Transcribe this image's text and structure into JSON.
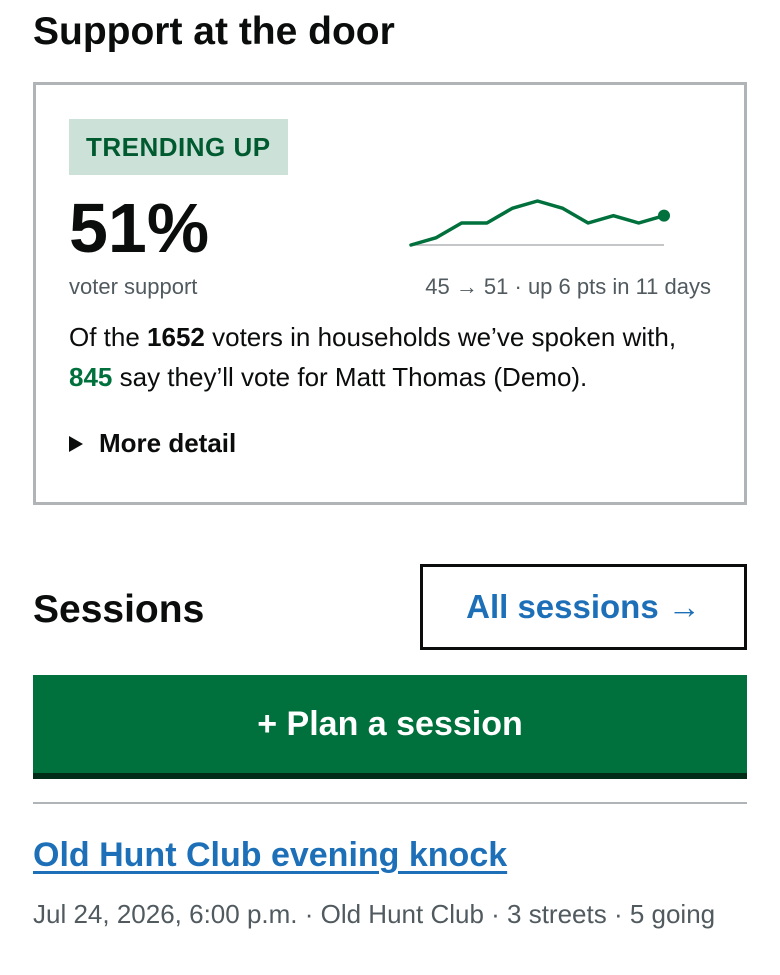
{
  "support": {
    "title": "Support at the door",
    "tag": "TRENDING UP",
    "percent": "51%",
    "percent_label": "voter support",
    "trend_caption": "45 → 51 · up 6 pts in 11 days",
    "trend_values": [
      45,
      46,
      48,
      48,
      50,
      51,
      50,
      48,
      49,
      48,
      49
    ],
    "colors": {
      "accent_green": "#00703c",
      "tag_bg": "#cce2d8",
      "link_blue": "#1d70b8"
    },
    "summary": {
      "part1": "Of the ",
      "voters": "1652",
      "part2": " voters in households we’ve spoken with, ",
      "supporters": "845",
      "part3": " say they’ll vote for Matt Thomas (Demo)."
    },
    "more_detail": "More detail"
  },
  "sessions": {
    "title": "Sessions",
    "all_link": "All sessions →",
    "plan_button": "+ Plan a session",
    "items": [
      {
        "name": "Old Hunt Club evening knock",
        "meta": "Jul 24, 2026, 6:00 p.m. · Old Hunt Club · 3 streets · 5 going"
      }
    ]
  }
}
